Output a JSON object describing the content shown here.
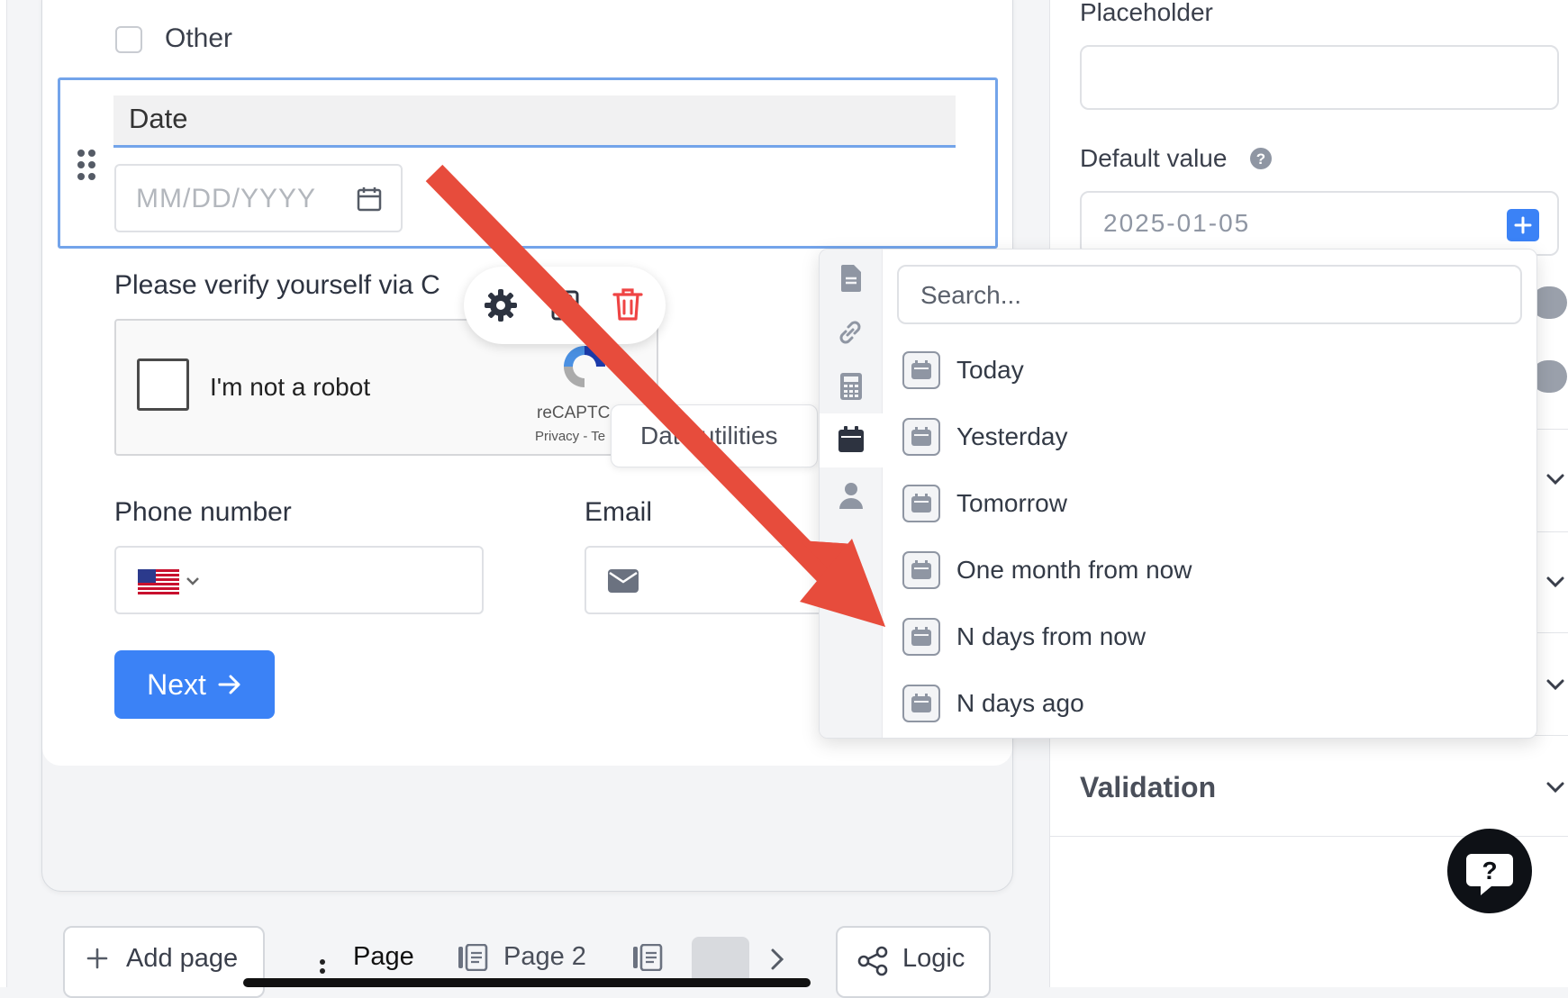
{
  "form": {
    "other_option_label": "Other",
    "date_field": {
      "title": "Date",
      "placeholder": "MM/DD/YYYY"
    },
    "captcha_section": {
      "label": "Please verify yourself via C",
      "checkbox_label": "I'm not a robot",
      "brand_text": "reCAPTC",
      "links_text": "Privacy - Te"
    },
    "tooltip_text": "Date utilities",
    "phone_label": "Phone number",
    "email_label": "Email",
    "next_label": "Next"
  },
  "bottom_bar": {
    "add_page_label": "Add page",
    "page1_label": "Page",
    "page2_label": "Page 2",
    "logic_label": "Logic"
  },
  "settings": {
    "placeholder_label": "Placeholder",
    "placeholder_value": "",
    "default_value_label": "Default value",
    "default_value": "2025-01-05",
    "validation_label": "Validation"
  },
  "dropdown": {
    "search_placeholder": "Search...",
    "items": [
      {
        "label": "Today"
      },
      {
        "label": "Yesterday"
      },
      {
        "label": "Tomorrow"
      },
      {
        "label": "One month from now"
      },
      {
        "label": "N days from now"
      },
      {
        "label": "N days ago"
      }
    ],
    "rail_icons": [
      "document-icon",
      "link-icon",
      "calculator-icon",
      "calendar-icon",
      "user-icon"
    ],
    "active_rail_icon": "calendar-icon"
  },
  "colors": {
    "accent": "#3b82f6",
    "selection_border": "#73a4ea",
    "danger": "#ef4444",
    "annotation_arrow": "#e74c3c"
  }
}
